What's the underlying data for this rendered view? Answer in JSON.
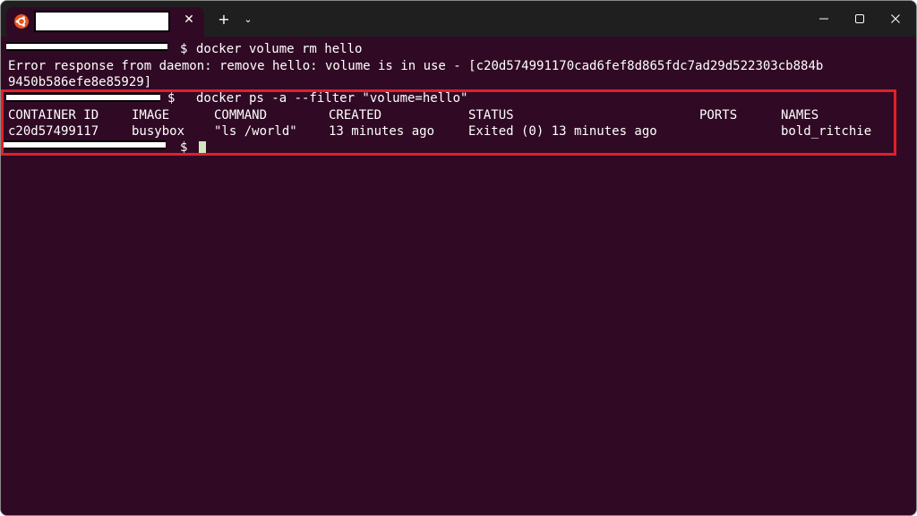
{
  "tab": {
    "title": "",
    "close_glyph": "✕"
  },
  "toolbar": {
    "new_tab_glyph": "+",
    "dropdown_glyph": "⌄"
  },
  "terminal": {
    "prompt_symbol": "$",
    "commands": [
      "docker volume rm hello",
      "docker ps -a --filter \"volume=hello\""
    ],
    "error_line1": "Error response from daemon: remove hello: volume is in use - [c20d574991170cad6fef8d865fdc7ad29d522303cb884b",
    "error_line2": "9450b586efe8e85929]",
    "table": {
      "headers": [
        "CONTAINER ID",
        "IMAGE",
        "COMMAND",
        "CREATED",
        "STATUS",
        "PORTS",
        "NAMES"
      ],
      "rows": [
        [
          "c20d57499117",
          "busybox",
          "\"ls /world\"",
          "13 minutes ago",
          "Exited (0) 13 minutes ago",
          "",
          "bold_ritchie"
        ]
      ]
    }
  },
  "colors": {
    "terminal_bg": "#300a24",
    "titlebar_bg": "#1f1f1f",
    "highlight_border": "#e0202a",
    "ubuntu_orange": "#e95420"
  },
  "icons": {
    "tab_icon": "ubuntu-icon",
    "close": "close-icon",
    "minimize": "minimize-icon",
    "maximize": "maximize-icon"
  }
}
